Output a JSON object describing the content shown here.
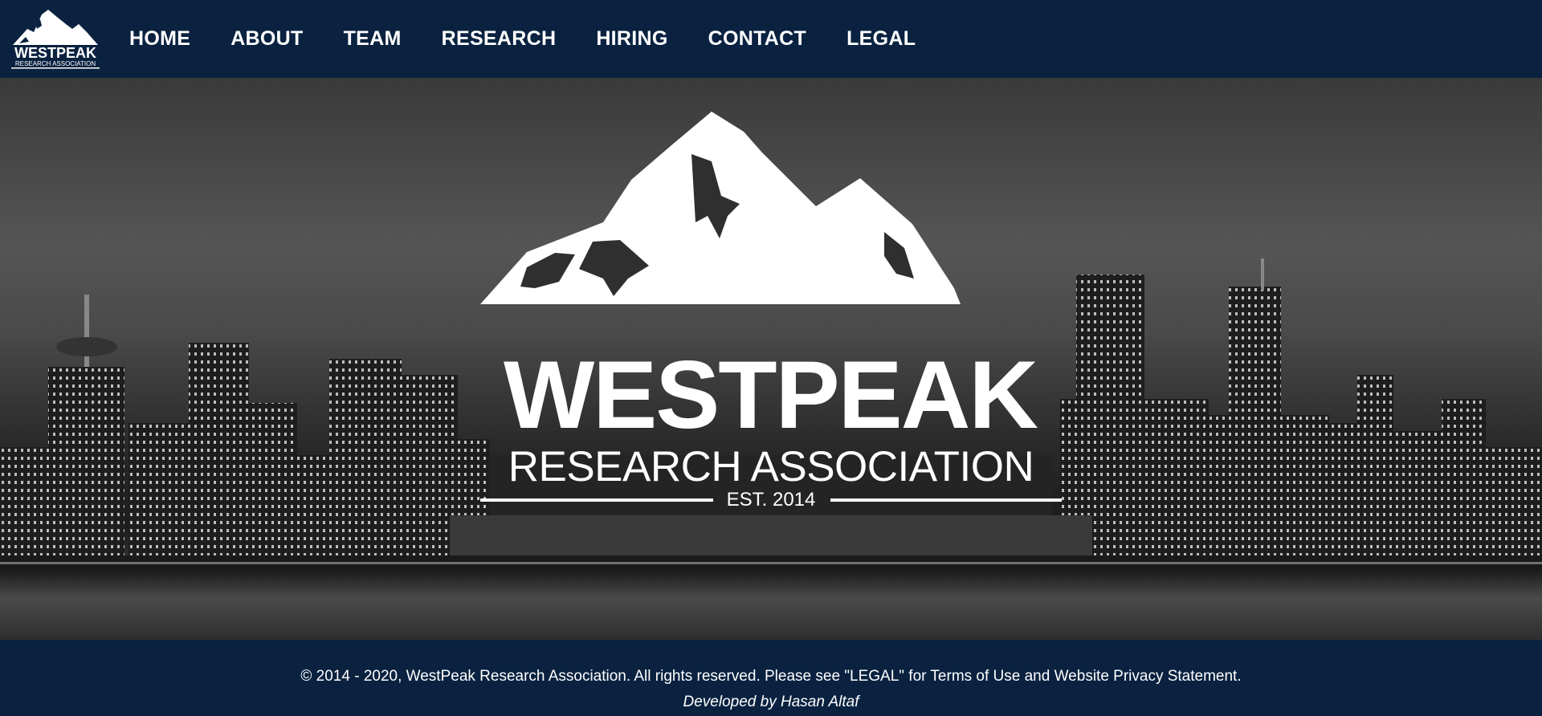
{
  "header": {
    "logo": {
      "icon": "mountain-logo-icon",
      "wordmark": "WESTPEAK",
      "tagline": "RESEARCH ASSOCIATION"
    },
    "nav": [
      {
        "label": "HOME"
      },
      {
        "label": "ABOUT"
      },
      {
        "label": "TEAM"
      },
      {
        "label": "RESEARCH"
      },
      {
        "label": "HIRING"
      },
      {
        "label": "CONTACT"
      },
      {
        "label": "LEGAL"
      }
    ]
  },
  "hero": {
    "title": "WESTPEAK",
    "subtitle": "RESEARCH ASSOCIATION",
    "est": "EST. 2014",
    "background": "city-skyline-night-image"
  },
  "footer": {
    "copyright": "© 2014 - 2020, WestPeak Research Association. All rights reserved. Please see \"LEGAL\" for Terms of Use and Website Privacy Statement.",
    "developer": "Developed by Hasan Altaf"
  },
  "colors": {
    "navy": "#0a2240",
    "white": "#ffffff"
  }
}
